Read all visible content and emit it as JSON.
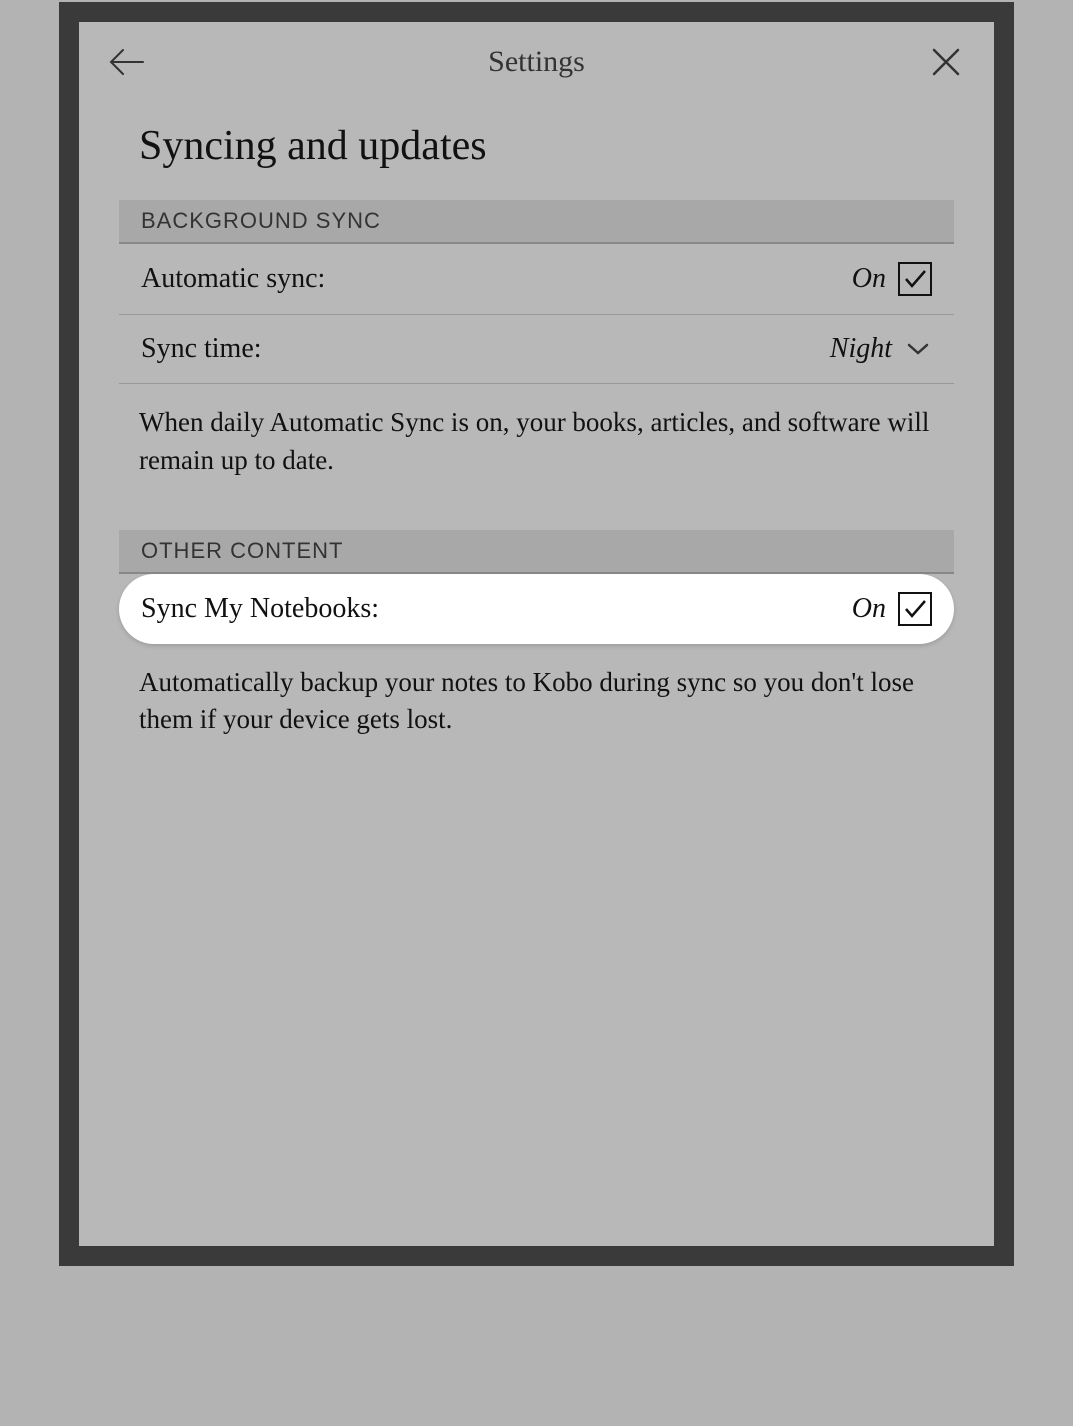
{
  "header": {
    "title": "Settings"
  },
  "page": {
    "title": "Syncing and updates"
  },
  "sections": {
    "background_sync": {
      "header": "BACKGROUND SYNC",
      "automatic_sync": {
        "label": "Automatic sync:",
        "value": "On"
      },
      "sync_time": {
        "label": "Sync time:",
        "value": "Night"
      },
      "description": "When daily Automatic Sync is on, your books, articles, and software will remain up to date."
    },
    "other_content": {
      "header": "OTHER CONTENT",
      "sync_notebooks": {
        "label": "Sync My Notebooks:",
        "value": "On"
      },
      "description": "Automatically backup your notes to Kobo during sync so you don't lose them if your device gets lost."
    }
  }
}
